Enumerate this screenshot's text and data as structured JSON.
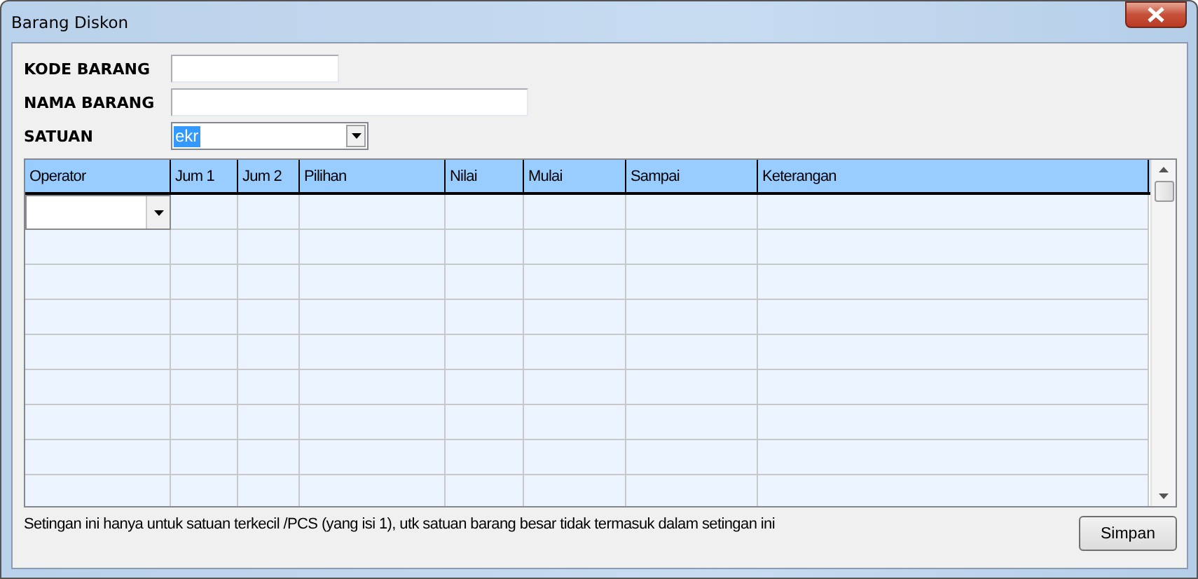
{
  "window": {
    "title": "Barang Diskon"
  },
  "form": [
    {
      "label": "KODE BARANG",
      "kind": "text"
    },
    {
      "label": "NAMA BARANG",
      "kind": "text"
    },
    {
      "label": "SATUAN",
      "kind": "combo",
      "value": "ekr",
      "selected": true
    }
  ],
  "grid": {
    "columns": [
      "Operator",
      "Jum 1",
      "Jum 2",
      "Pilihan",
      "Nilai",
      "Mulai",
      "Sampai",
      "Keterangan"
    ],
    "rows": [
      {
        "kind": "editor"
      },
      {
        "kind": "blank"
      },
      {
        "kind": "blank"
      },
      {
        "kind": "blank"
      },
      {
        "kind": "blank"
      },
      {
        "kind": "blank"
      },
      {
        "kind": "blank"
      },
      {
        "kind": "blank"
      },
      {
        "kind": "blank"
      }
    ]
  },
  "note": "Setingan ini hanya untuk satuan terkecil /PCS (yang isi 1), utk satuan barang besar tidak termasuk dalam setingan ini",
  "buttons": [
    "Simpan"
  ]
}
